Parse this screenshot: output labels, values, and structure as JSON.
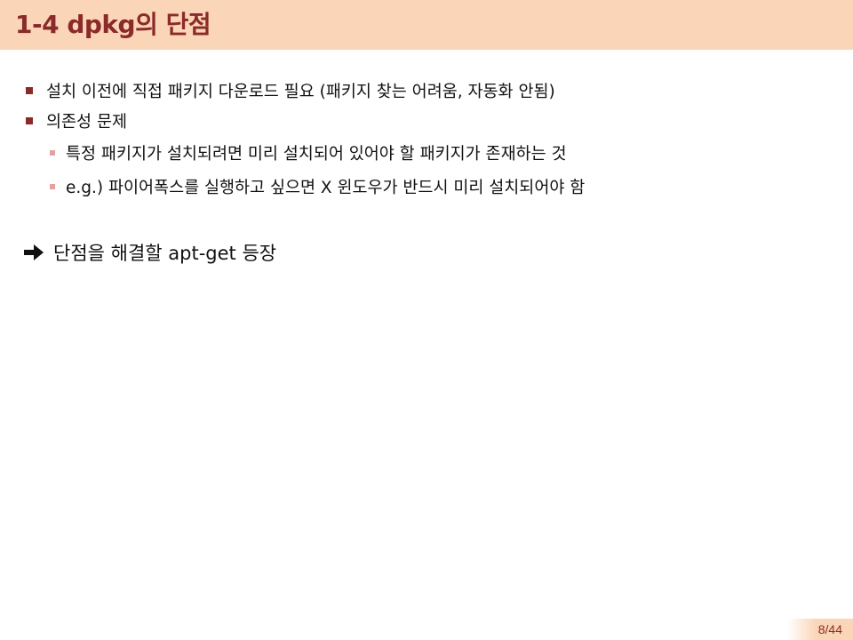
{
  "slide": {
    "title": "1-4 dpkg의 단점",
    "bullets": [
      {
        "level": 1,
        "text": "설치 이전에 직접 패키지 다운로드 필요 (패키지 찾는 어려움, 자동화 안됨)"
      },
      {
        "level": 1,
        "text": "의존성 문제"
      },
      {
        "level": 2,
        "text": "특정 패키지가 설치되려면 미리 설치되어 있어야 할 패키지가 존재하는 것"
      },
      {
        "level": 2,
        "text": "e.g.) 파이어폭스를 실행하고 싶으면 X 윈도우가 반드시 미리 설치되어야 함"
      }
    ],
    "conclusion": "단점을 해결할 apt-get 등장",
    "page_number": "8/44"
  },
  "colors": {
    "header_bg": "#fbd5b7",
    "title_color": "#8a2a2a",
    "bullet_l1": "#8a2a2a",
    "bullet_l2": "#e6a0a0"
  },
  "icons": {
    "conclusion_marker": "right-arrow-icon"
  }
}
